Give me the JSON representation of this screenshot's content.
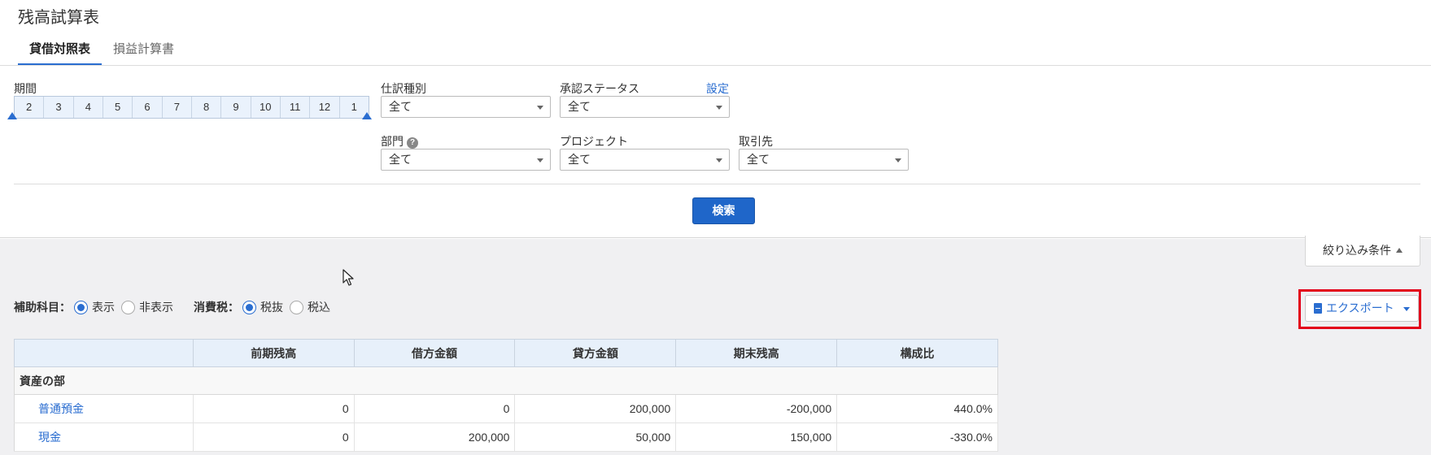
{
  "page": {
    "title": "残高試算表"
  },
  "tabs": [
    {
      "label": "貸借対照表",
      "active": true
    },
    {
      "label": "損益計算書",
      "active": false
    }
  ],
  "filters": {
    "period_label": "期間",
    "period_months": [
      "2",
      "3",
      "4",
      "5",
      "6",
      "7",
      "8",
      "9",
      "10",
      "11",
      "12",
      "1"
    ],
    "entry_type": {
      "label": "仕訳種別",
      "value": "全て"
    },
    "approval_status": {
      "label": "承認ステータス",
      "value": "全て",
      "settings_link": "設定"
    },
    "department": {
      "label": "部門",
      "value": "全て",
      "help": "?"
    },
    "project": {
      "label": "プロジェクト",
      "value": "全て"
    },
    "partner": {
      "label": "取引先",
      "value": "全て"
    },
    "search_button": "検索",
    "toggle_label": "絞り込み条件"
  },
  "options": {
    "sub_account": {
      "label": "補助科目：",
      "choices": [
        "表示",
        "非表示"
      ],
      "selected": "表示"
    },
    "consumption_tax": {
      "label": "消費税：",
      "choices": [
        "税抜",
        "税込"
      ],
      "selected": "税抜"
    }
  },
  "export_button": "エクスポート",
  "table": {
    "headers": [
      "",
      "前期残高",
      "借方金額",
      "貸方金額",
      "期末残高",
      "構成比"
    ],
    "section": "資産の部",
    "rows": [
      [
        "普通預金",
        "0",
        "0",
        "200,000",
        "-200,000",
        "440.0%"
      ],
      [
        "現金",
        "0",
        "200,000",
        "50,000",
        "150,000",
        "-330.0%"
      ]
    ]
  },
  "colors": {
    "accent": "#2a6dd0",
    "primary_button": "#1f66c9",
    "highlight_border": "#e3001a",
    "header_bg": "#e7f0fa"
  }
}
